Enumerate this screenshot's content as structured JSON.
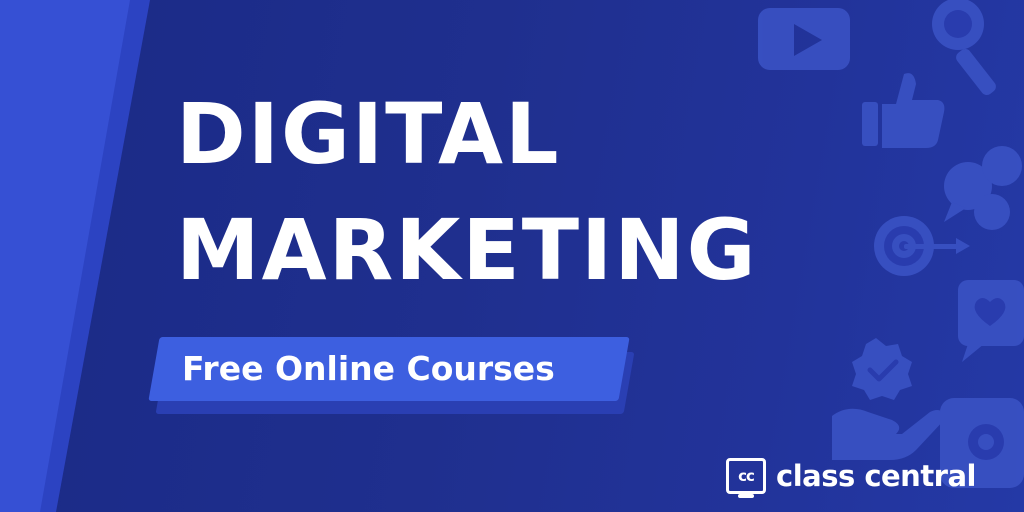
{
  "headline": {
    "line1": "DIGITAL",
    "line2": "MARKETING"
  },
  "tag": {
    "label": "Free Online Courses"
  },
  "brand": {
    "logo_mark": "cc",
    "name": "class central"
  },
  "colors": {
    "background": "#1f2f8e",
    "accent": "#3d5fe0",
    "text": "#ffffff",
    "icon": "#3a52c4"
  },
  "icons": [
    "video-play-icon",
    "magnifier-icon",
    "thumbs-up-icon",
    "chat-bubbles-icon",
    "target-icon",
    "heart-message-icon",
    "verified-badge-icon",
    "hand-icon",
    "image-icon"
  ]
}
